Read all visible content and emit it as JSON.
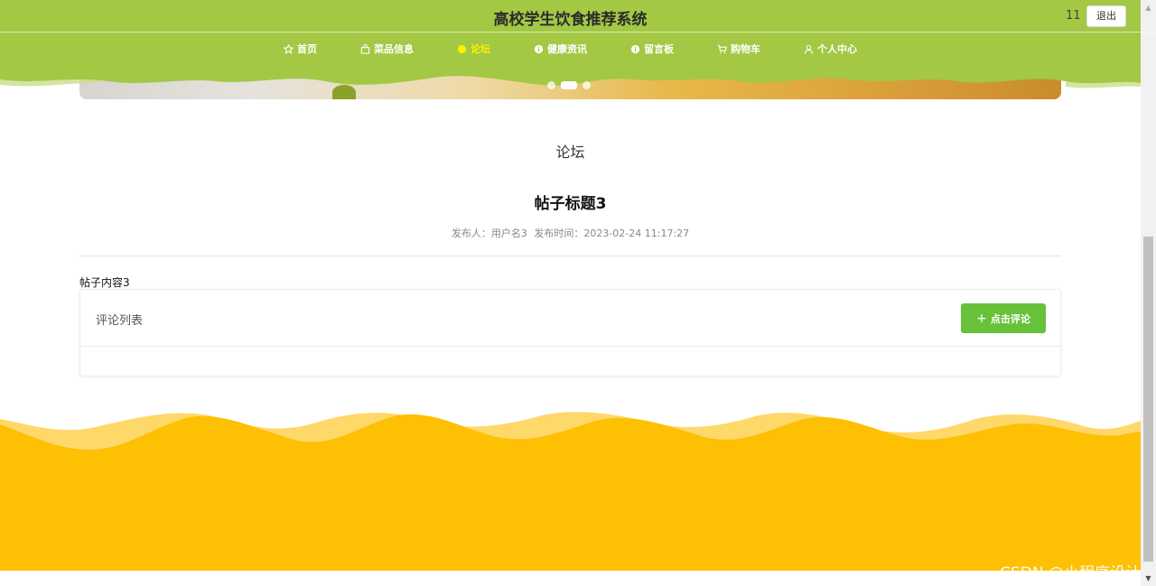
{
  "header": {
    "site_title": "高校学生饮食推荐系统",
    "user_name": "11",
    "logout_label": "退出",
    "nav": [
      {
        "label": "首页",
        "icon": "star-icon",
        "active": false
      },
      {
        "label": "菜品信息",
        "icon": "bag-icon",
        "active": false
      },
      {
        "label": "论坛",
        "icon": "circle-icon",
        "active": true
      },
      {
        "label": "健康资讯",
        "icon": "info-icon",
        "active": false
      },
      {
        "label": "留言板",
        "icon": "info-icon",
        "active": false
      },
      {
        "label": "购物车",
        "icon": "cart-icon",
        "active": false
      },
      {
        "label": "个人中心",
        "icon": "user-icon",
        "active": false
      }
    ]
  },
  "main": {
    "section_title": "论坛",
    "post": {
      "title": "帖子标题3",
      "author_label": "发布人：用户名3",
      "time_label": "发布时间：2023-02-24 11:17:27",
      "content": "帖子内容3"
    },
    "comments": {
      "title": "评论列表",
      "add_button_label": "点击评论"
    }
  },
  "watermark": "CSDN @小程序设计",
  "colors": {
    "header_green": "#a2c844",
    "nav_active": "#ffef00",
    "button_green": "#67c23a",
    "footer_yellow": "#fec002",
    "footer_light_yellow": "#ffd86a"
  }
}
